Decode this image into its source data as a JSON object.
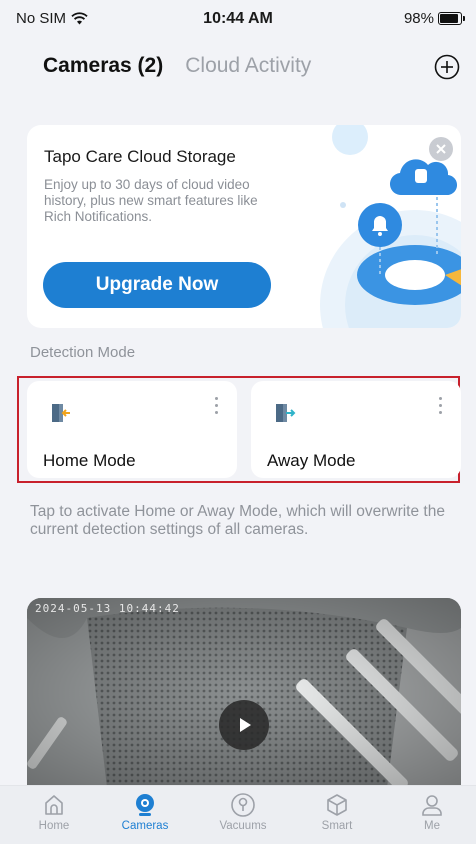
{
  "status_bar": {
    "carrier": "No SIM",
    "time": "10:44 AM",
    "battery": "98%"
  },
  "header": {
    "tabs": [
      {
        "label": "Cameras (2)"
      },
      {
        "label": "Cloud Activity"
      }
    ],
    "add_icon": "plus-circle-icon"
  },
  "promo": {
    "title": "Tapo Care Cloud Storage",
    "description": "Enjoy up to 30 days of cloud video history, plus new smart features like Rich Notifications.",
    "button_label": "Upgrade Now",
    "close_icon": "close-icon",
    "accent_color": "#1e7fd2"
  },
  "detection": {
    "section_label": "Detection Mode",
    "modes": [
      {
        "label": "Home Mode",
        "icon": "home-mode-icon",
        "more_icon": "more-vertical-icon"
      },
      {
        "label": "Away Mode",
        "icon": "away-mode-icon",
        "more_icon": "more-vertical-icon"
      }
    ],
    "info": "Tap to activate Home or Away Mode, which will overwrite the current detection settings of all cameras."
  },
  "camera": {
    "timestamp": "2024-05-13 10:44:42",
    "play_icon": "play-icon"
  },
  "bottom_nav": [
    {
      "label": "Home",
      "icon": "home-icon"
    },
    {
      "label": "Cameras",
      "icon": "camera-icon",
      "active": true
    },
    {
      "label": "Vacuums",
      "icon": "vacuum-icon"
    },
    {
      "label": "Smart",
      "icon": "cube-icon"
    },
    {
      "label": "Me",
      "icon": "person-icon"
    }
  ],
  "colors": {
    "active": "#1e7fd2",
    "inactive": "#9da1a8",
    "highlight": "#c8202c"
  }
}
